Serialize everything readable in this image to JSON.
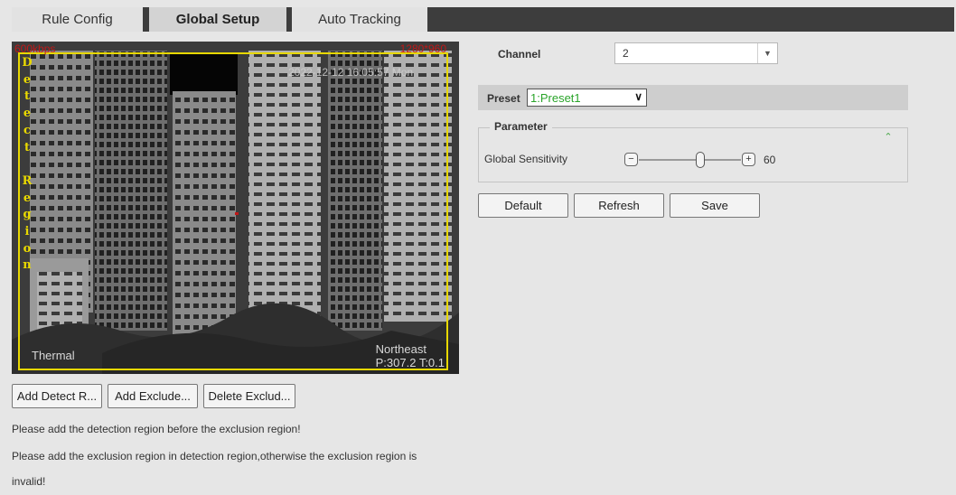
{
  "tabs": [
    {
      "label": "Rule Config"
    },
    {
      "label": "Global Setup"
    },
    {
      "label": "Auto Tracking"
    }
  ],
  "video": {
    "bitrate": "600kbps",
    "resolution": "1280*960",
    "timestamp": "2022-12-12 16:05:57 Mon",
    "mode": "Thermal",
    "direction": "Northeast",
    "ptz": "P:307.2 T:0.1",
    "region_label": [
      "D",
      "e",
      "t",
      "e",
      "c",
      "t",
      "",
      "R",
      "e",
      "g",
      "i",
      "o",
      "n"
    ]
  },
  "video_buttons": {
    "add_detect": "Add Detect R...",
    "add_exclude": "Add Exclude...",
    "delete_exclude": "Delete Exclud..."
  },
  "notes": {
    "line1": "Please add the detection region before the exclusion region!",
    "line2": "Please add the exclusion region in detection region,otherwise the exclusion region is",
    "line3": "invalid!"
  },
  "channel": {
    "label": "Channel",
    "value": "2"
  },
  "preset": {
    "label": "Preset",
    "value": "1:Preset1"
  },
  "parameter": {
    "legend": "Parameter",
    "sensitivity_label": "Global Sensitivity",
    "sensitivity_value": "60",
    "sensitivity_fraction": 0.6
  },
  "actions": {
    "default": "Default",
    "refresh": "Refresh",
    "save": "Save"
  },
  "colors": {
    "overlay_red": "#c01818",
    "region_yellow": "#e8d800",
    "preset_green": "#2aa42a",
    "tabbar": "#3d3d3d"
  }
}
